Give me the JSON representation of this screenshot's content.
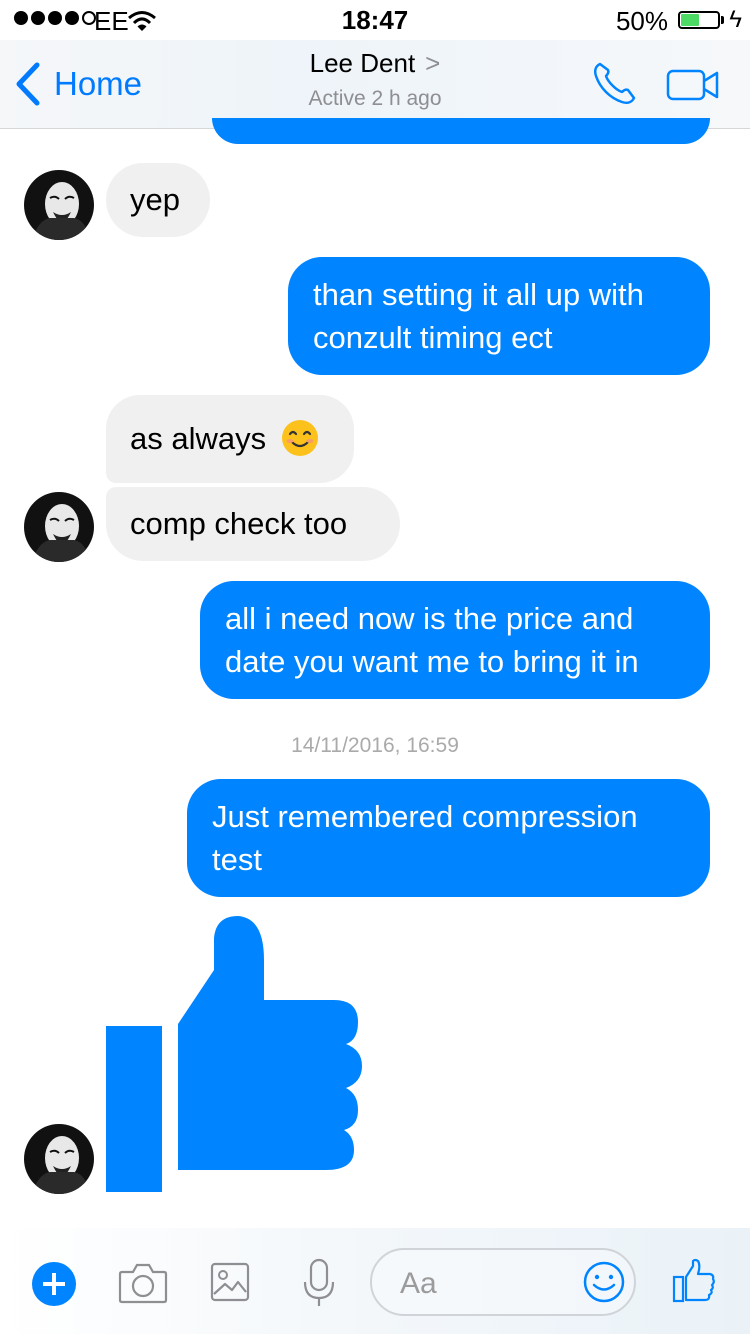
{
  "status_bar": {
    "carrier": "EE",
    "time": "18:47",
    "battery_percent": "50%",
    "battery_level": 0.5
  },
  "header": {
    "back_label": "Home",
    "contact_name": "Lee Dent",
    "contact_status": "Active 2 h ago"
  },
  "messages": [
    {
      "direction": "in",
      "text": "yep"
    },
    {
      "direction": "out",
      "lines": [
        "than setting it all up with",
        "conzult timing ect"
      ]
    },
    {
      "direction": "in",
      "text": "as always",
      "emoji": "smiling-face"
    },
    {
      "direction": "in",
      "text": "comp check too"
    },
    {
      "direction": "out",
      "lines": [
        "all i need now is the price and",
        "date you want me to bring it in"
      ]
    },
    {
      "direction": "out",
      "lines": [
        "Just remembered compression",
        "test"
      ]
    },
    {
      "direction": "in",
      "sticker": "thumbs-up-icon"
    }
  ],
  "timestamp": "14/11/2016, 16:59",
  "composer": {
    "placeholder": "Aa"
  },
  "colors": {
    "accent": "#0084ff",
    "incoming_bubble": "#f1f0f0",
    "ios_blue": "#007aff"
  }
}
